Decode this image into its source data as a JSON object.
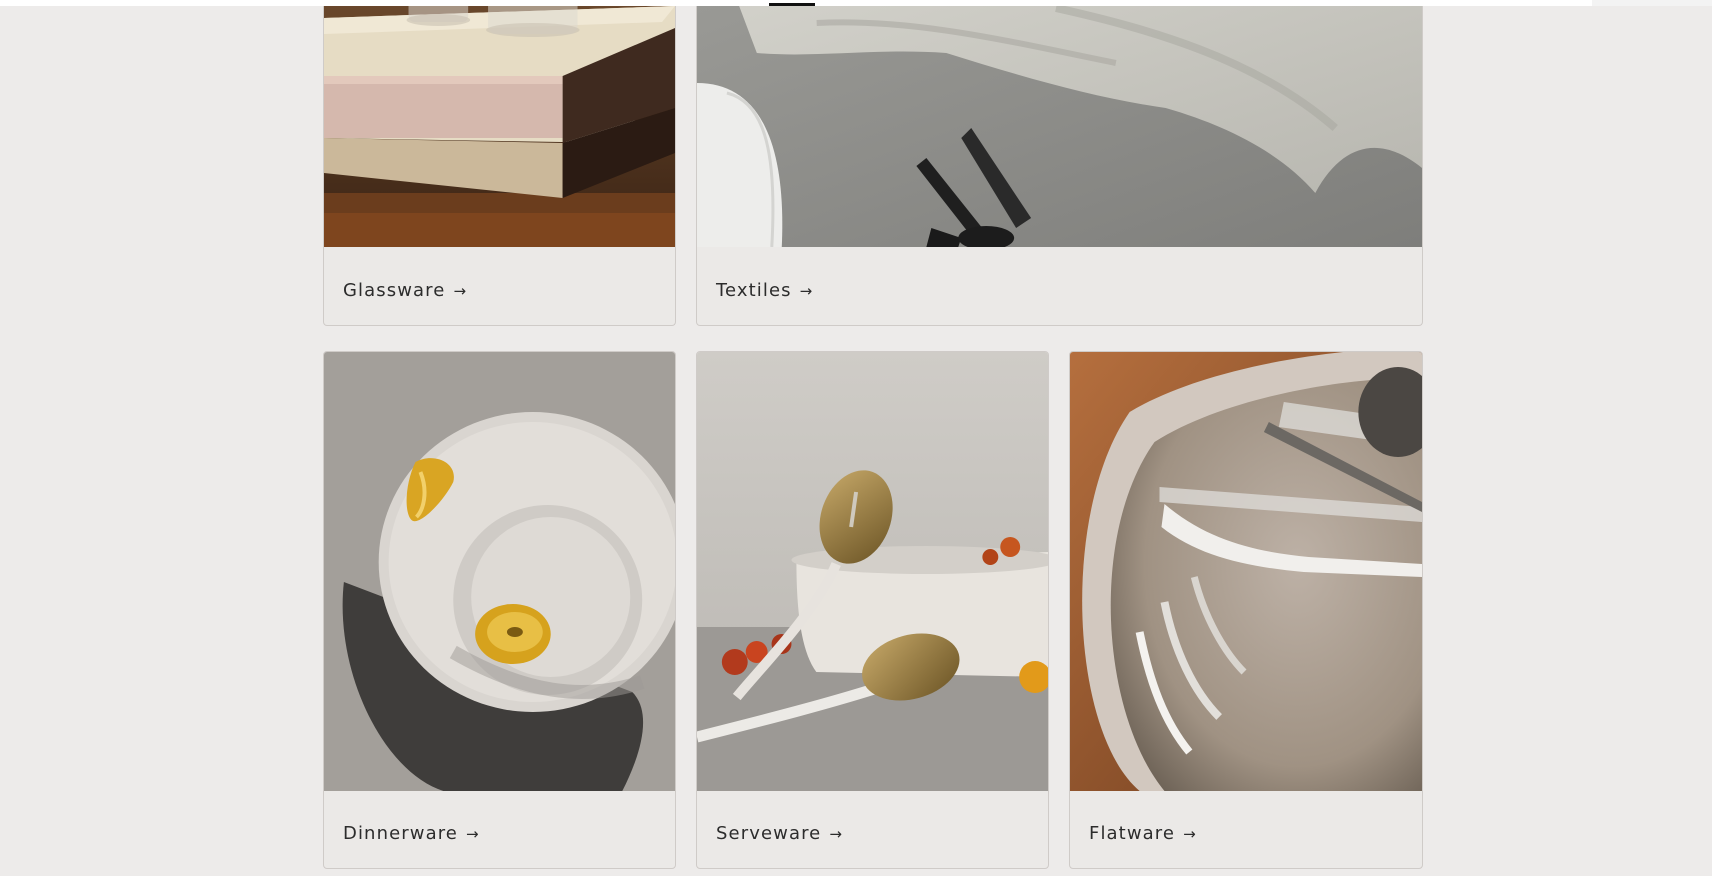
{
  "collections": {
    "row1": [
      {
        "label": "Glassware",
        "arrow": "→",
        "image": "glassware-books-photo"
      },
      {
        "label": "Textiles",
        "arrow": "→",
        "image": "linen-napkin-cutlery-photo"
      }
    ],
    "row2": [
      {
        "label": "Dinnerware",
        "arrow": "→",
        "image": "plates-kiwi-photo"
      },
      {
        "label": "Serveware",
        "arrow": "→",
        "image": "gold-servers-bowl-tomatoes-photo"
      },
      {
        "label": "Flatware",
        "arrow": "→",
        "image": "fork-knife-plate-photo"
      }
    ]
  },
  "colors": {
    "page_background": "#edebea",
    "card_background": "#ebe9e7",
    "card_border": "#cfcbc8",
    "caption_text": "#2c2c2c"
  }
}
